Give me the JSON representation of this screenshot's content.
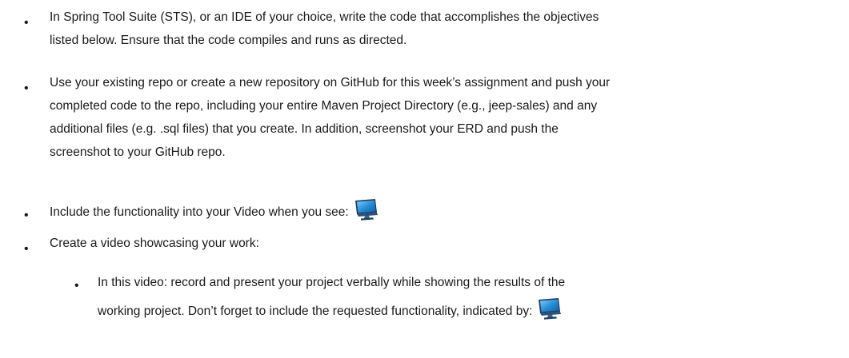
{
  "bullet_glyph": "•",
  "items": [
    {
      "lines": [
        "In Spring Tool Suite (STS), or an IDE of your choice, write the code that accomplishes the objectives",
        "listed below. Ensure that the code compiles and runs as directed."
      ]
    },
    {
      "lines": [
        "Use your existing repo or create a new repository on GitHub for this week’s assignment and push your",
        "completed code to the repo, including your entire Maven Project Directory (e.g., jeep-sales) and any",
        "additional files (e.g. .sql files) that you create.  In addition, screenshot your ERD and push the",
        "screenshot to your GitHub repo."
      ]
    },
    {
      "lines": [
        "Include the functionality into your Video when you see:"
      ],
      "icon": "monitor-icon"
    },
    {
      "lines": [
        "Create a video showcasing your work:"
      ],
      "sub_items": [
        {
          "lines": [
            "In this video: record and present your project verbally while showing the results of the",
            "working project.   Don’t forget to include the requested functionality, indicated by:"
          ],
          "icon": "monitor-icon"
        }
      ]
    }
  ],
  "colors": {
    "text": "#1a1a1a",
    "icon_screen": "#2a8fd6",
    "icon_frame": "#1c3f66"
  }
}
